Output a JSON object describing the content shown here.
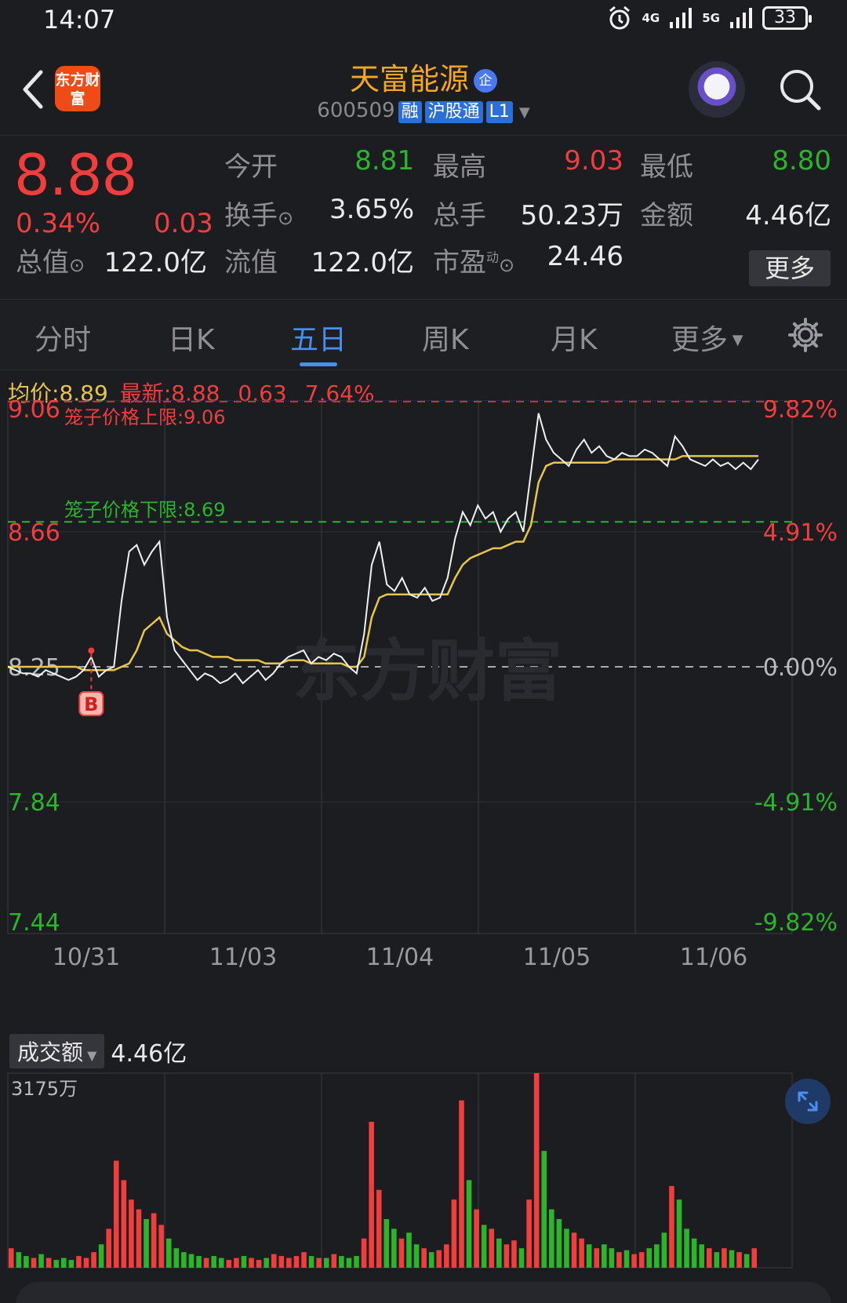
{
  "status": {
    "time": "14:07",
    "net1": "4G",
    "net2": "5G",
    "battery": "33"
  },
  "nav": {
    "app_logo": "东方财富",
    "stock_name": "天富能源",
    "qi_badge": "企",
    "code": "600509",
    "tags": [
      "融",
      "沪股通",
      "L1"
    ]
  },
  "quote": {
    "price": "8.88",
    "pct": "0.34%",
    "change": "0.03",
    "today_open_label": "今开",
    "today_open": "8.81",
    "high_label": "最高",
    "high": "9.03",
    "low_label": "最低",
    "low": "8.80",
    "turnover_label": "换手",
    "turnover": "3.65%",
    "volume_label": "总手",
    "volume": "50.23万",
    "amount_label": "金额",
    "amount": "4.46亿",
    "mcap_label": "总值",
    "mcap": "122.0亿",
    "float_label": "流值",
    "float": "122.0亿",
    "pe_label": "市盈",
    "pe_sup": "动",
    "pe": "24.46",
    "more_label": "更多"
  },
  "tabs": [
    "分时",
    "日K",
    "五日",
    "周K",
    "月K",
    "更多"
  ],
  "active_tab": "五日",
  "avg_bar": {
    "avg_label": "均价:",
    "avg": "8.89",
    "last_label": "最新:",
    "last": "8.88",
    "chg": "0.63",
    "pct": "7.64%"
  },
  "colors": {
    "up": "#f23d3d",
    "down": "#2bb52b",
    "price_line": "#f0f0f0",
    "avg_line": "#e8c54a",
    "accent": "#4a8ff0"
  },
  "chart_data": {
    "type": "line",
    "title": "",
    "x_labels": [
      "10/31",
      "11/03",
      "11/04",
      "11/05",
      "11/06"
    ],
    "y_left_labels": [
      "9.06",
      "8.66",
      "8.25",
      "7.84",
      "7.44"
    ],
    "y_right_labels": [
      "9.82%",
      "4.91%",
      "0.00%",
      "-4.91%",
      "-9.82%"
    ],
    "ylim": [
      7.44,
      9.06
    ],
    "prev_close": 8.25,
    "upper_limit_label": "笼子价格上限:",
    "upper_limit": "9.06",
    "lower_limit_label": "笼子价格下限:",
    "lower_limit": "8.69",
    "marker": "B",
    "series": [
      {
        "values": [
          8.25,
          8.24,
          8.23,
          8.23,
          8.22,
          8.24,
          8.23,
          8.22,
          8.21,
          8.22,
          8.24,
          8.28,
          8.22,
          8.24,
          8.25,
          8.45,
          8.6,
          8.62,
          8.56,
          8.6,
          8.63,
          8.4,
          8.3,
          8.27,
          8.24,
          8.21,
          8.23,
          8.22,
          8.2,
          8.21,
          8.23,
          8.2,
          8.22,
          8.24,
          8.21,
          8.23,
          8.26,
          8.28,
          8.29,
          8.3,
          8.26,
          8.28,
          8.27,
          8.29,
          8.28,
          8.25,
          8.23,
          8.35,
          8.56,
          8.63,
          8.5,
          8.48,
          8.52,
          8.47,
          8.46,
          8.49,
          8.45,
          8.46,
          8.52,
          8.64,
          8.72,
          8.68,
          8.74,
          8.7,
          8.72,
          8.66,
          8.7,
          8.72,
          8.66,
          8.84,
          9.02,
          8.94,
          8.9,
          8.88,
          8.86,
          8.91,
          8.94,
          8.9,
          8.92,
          8.89,
          8.88,
          8.9,
          8.89,
          8.89,
          8.91,
          8.9,
          8.88,
          8.86,
          8.95,
          8.92,
          8.88,
          8.87,
          8.86,
          8.88,
          8.86,
          8.87,
          8.85,
          8.87,
          8.85,
          8.88
        ]
      },
      {
        "values": [
          8.25,
          8.25,
          8.25,
          8.25,
          8.25,
          8.25,
          8.25,
          8.25,
          8.25,
          8.25,
          8.24,
          8.24,
          8.24,
          8.24,
          8.24,
          8.25,
          8.26,
          8.3,
          8.36,
          8.38,
          8.4,
          8.35,
          8.33,
          8.31,
          8.3,
          8.3,
          8.29,
          8.28,
          8.28,
          8.28,
          8.27,
          8.27,
          8.27,
          8.27,
          8.26,
          8.26,
          8.26,
          8.27,
          8.27,
          8.27,
          8.26,
          8.26,
          8.26,
          8.26,
          8.26,
          8.25,
          8.25,
          8.28,
          8.4,
          8.46,
          8.47,
          8.47,
          8.47,
          8.47,
          8.47,
          8.47,
          8.47,
          8.47,
          8.47,
          8.52,
          8.56,
          8.58,
          8.59,
          8.6,
          8.61,
          8.61,
          8.62,
          8.63,
          8.63,
          8.68,
          8.81,
          8.86,
          8.87,
          8.87,
          8.87,
          8.87,
          8.87,
          8.87,
          8.87,
          8.87,
          8.88,
          8.88,
          8.88,
          8.88,
          8.88,
          8.88,
          8.88,
          8.88,
          8.88,
          8.89,
          8.89,
          8.89,
          8.89,
          8.89,
          8.89,
          8.89,
          8.89,
          8.89,
          8.89,
          8.89
        ]
      }
    ],
    "volume": {
      "label": "成交额",
      "total": "4.46亿",
      "max_label": "3175万",
      "values": [
        0.1,
        0.08,
        0.06,
        0.05,
        0.07,
        0.05,
        0.04,
        0.05,
        0.04,
        0.06,
        0.05,
        0.08,
        0.12,
        0.2,
        0.55,
        0.45,
        0.35,
        0.3,
        0.25,
        0.28,
        0.22,
        0.15,
        0.1,
        0.08,
        0.07,
        0.06,
        0.05,
        0.06,
        0.05,
        0.04,
        0.05,
        0.06,
        0.05,
        0.04,
        0.05,
        0.07,
        0.06,
        0.05,
        0.06,
        0.08,
        0.06,
        0.05,
        0.05,
        0.07,
        0.06,
        0.05,
        0.06,
        0.15,
        0.75,
        0.4,
        0.25,
        0.2,
        0.15,
        0.18,
        0.12,
        0.1,
        0.08,
        0.09,
        0.12,
        0.35,
        0.86,
        0.45,
        0.3,
        0.22,
        0.2,
        0.15,
        0.12,
        0.14,
        0.1,
        0.35,
        1.0,
        0.6,
        0.3,
        0.25,
        0.2,
        0.18,
        0.15,
        0.12,
        0.1,
        0.12,
        0.1,
        0.08,
        0.09,
        0.07,
        0.08,
        0.1,
        0.12,
        0.18,
        0.42,
        0.35,
        0.2,
        0.15,
        0.12,
        0.1,
        0.08,
        0.1,
        0.09,
        0.08,
        0.07,
        0.1
      ]
    }
  }
}
